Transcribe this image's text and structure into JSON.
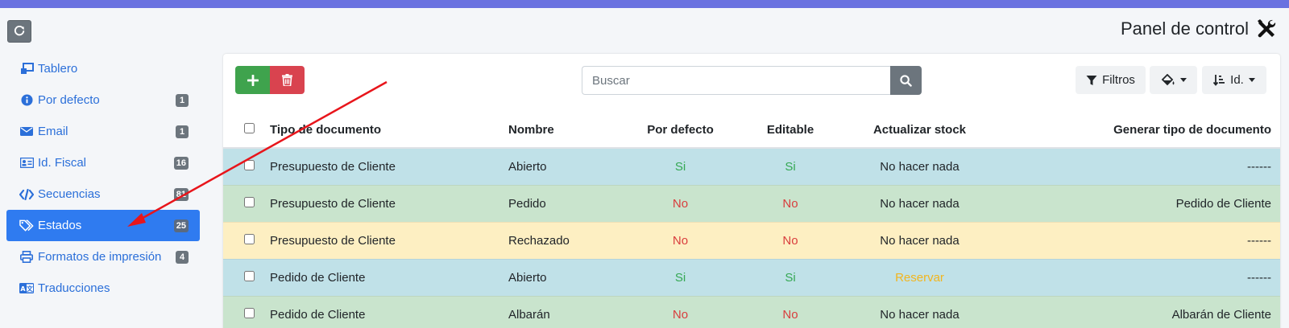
{
  "header": {
    "title": "Panel de control",
    "tools_icon": "tools-icon",
    "refresh_icon": "refresh-icon"
  },
  "sidebar": {
    "items": [
      {
        "label": "Tablero",
        "icon": "dashboard-icon",
        "badge": ""
      },
      {
        "label": "Por defecto",
        "icon": "info-icon",
        "badge": "1"
      },
      {
        "label": "Email",
        "icon": "envelope-icon",
        "badge": "1"
      },
      {
        "label": "Id. Fiscal",
        "icon": "id-card-icon",
        "badge": "16"
      },
      {
        "label": "Secuencias",
        "icon": "code-icon",
        "badge": "81"
      },
      {
        "label": "Estados",
        "icon": "tags-icon",
        "badge": "25",
        "active": true
      },
      {
        "label": "Formatos de impresión",
        "icon": "printer-icon",
        "badge": "4"
      },
      {
        "label": "Traducciones",
        "icon": "language-icon",
        "badge": ""
      }
    ]
  },
  "toolbar": {
    "add_icon": "plus-icon",
    "delete_icon": "trash-icon",
    "search_placeholder": "Buscar",
    "search_icon": "search-icon",
    "filters_label": "Filtros",
    "color_icon": "paint-bucket-icon",
    "sort_label": "Id."
  },
  "table": {
    "columns": [
      "Tipo de documento",
      "Nombre",
      "Por defecto",
      "Editable",
      "Actualizar stock",
      "Generar tipo de documento"
    ],
    "rows": [
      {
        "tipo": "Presupuesto de Cliente",
        "nombre": "Abierto",
        "defecto": "Si",
        "editable": "Si",
        "stock": "No hacer nada",
        "generar": "------",
        "row_color": "info"
      },
      {
        "tipo": "Presupuesto de Cliente",
        "nombre": "Pedido",
        "defecto": "No",
        "editable": "No",
        "stock": "No hacer nada",
        "generar": "Pedido de Cliente",
        "row_color": "success"
      },
      {
        "tipo": "Presupuesto de Cliente",
        "nombre": "Rechazado",
        "defecto": "No",
        "editable": "No",
        "stock": "No hacer nada",
        "generar": "------",
        "row_color": "warning"
      },
      {
        "tipo": "Pedido de Cliente",
        "nombre": "Abierto",
        "defecto": "Si",
        "editable": "Si",
        "stock": "Reservar",
        "generar": "------",
        "row_color": "info"
      },
      {
        "tipo": "Pedido de Cliente",
        "nombre": "Albarán",
        "defecto": "No",
        "editable": "No",
        "stock": "No hacer nada",
        "generar": "Albarán de Cliente",
        "row_color": "success"
      }
    ]
  },
  "colors": {
    "accent": "#2f7bf0",
    "topbar": "#6a72e0",
    "yes": "#34a853",
    "no": "#d93d3d",
    "warn": "#f2b51e",
    "arrow": "#e8151b"
  }
}
